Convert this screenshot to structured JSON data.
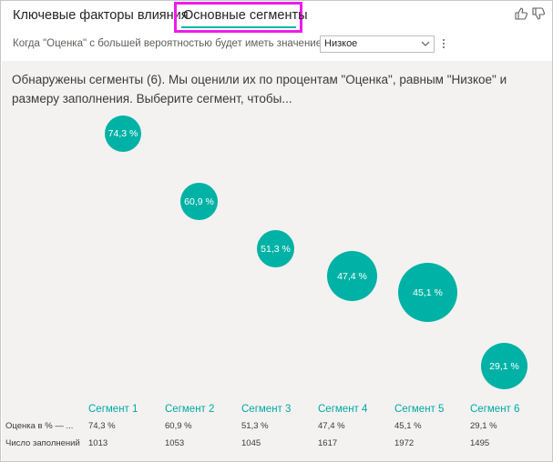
{
  "tabs": {
    "key_influencers": "Ключевые факторы влияния",
    "top_segments": "Основные сегменты"
  },
  "icons": {
    "thumb_up": "thumb-up-icon",
    "thumb_down": "thumb-down-icon",
    "more": "more-vertical-icon",
    "chevron": "chevron-down-icon"
  },
  "condition": {
    "label": "Когда \"Оценка\" с большей вероятностью будет иметь значение",
    "selected_value": "Низкое"
  },
  "description": "Обнаружены сегменты (6). Мы оценили их по процентам \"Оценка\", равным \"Низкое\" и размеру заполнения. Выберите сегмент, чтобы...",
  "colors": {
    "bubble": "#00b2a5",
    "accent": "#01b8aa",
    "segment_label": "#01a8a1",
    "highlight_border": "#ee1aee",
    "panel_bg": "#f3f2f1"
  },
  "row_labels": {
    "rating": "Оценка в % — ...",
    "population": "Число заполнений"
  },
  "segments": [
    {
      "name": "Сегмент 1",
      "pct_label": "74,3 %",
      "rating": "74,3 %",
      "population": "1013"
    },
    {
      "name": "Сегмент 2",
      "pct_label": "60,9 %",
      "rating": "60,9 %",
      "population": "1053"
    },
    {
      "name": "Сегмент 3",
      "pct_label": "51,3 %",
      "rating": "51,3 %",
      "population": "1045"
    },
    {
      "name": "Сегмент 4",
      "pct_label": "47,4 %",
      "rating": "47,4 %",
      "population": "1617"
    },
    {
      "name": "Сегмент 5",
      "pct_label": "45,1 %",
      "rating": "45,1 %",
      "population": "1972"
    },
    {
      "name": "Сегмент 6",
      "pct_label": "29,1 %",
      "rating": "29,1 %",
      "population": "1495"
    }
  ]
}
